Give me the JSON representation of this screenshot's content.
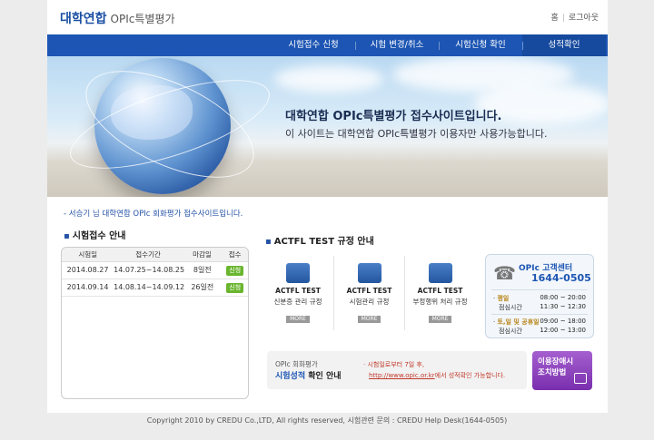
{
  "header": {
    "logo_main": "대학연합",
    "logo_sub": "OPIc특별평가",
    "util": [
      "홈",
      "로그아웃"
    ]
  },
  "nav": [
    "시험접수 신청",
    "시험 변경/취소",
    "시험신청 확인",
    "성적확인"
  ],
  "hero": {
    "title": "대학연합 OPIc특별평가 접수사이트입니다.",
    "subtitle": "이 사이트는 대학연합 OPIc특별평가 이용자만 사용가능합니다."
  },
  "notice": "- 서승기 님 대학연합 OPIc 회화평가 접수사이트입니다.",
  "schedule": {
    "title": "시험접수 안내",
    "columns": [
      "시험일",
      "접수기간",
      "마감일",
      "접수"
    ],
    "rows": [
      {
        "date": "2014.08.27",
        "period": "14.07.25~14.08.25",
        "deadline": "8일전",
        "action": "신청"
      },
      {
        "date": "2014.09.14",
        "period": "14.08.14~14.09.12",
        "deadline": "26일전",
        "action": "신청"
      }
    ]
  },
  "rules": {
    "title": "ACTFL TEST 규정 안내",
    "items": [
      {
        "title": "ACTFL TEST",
        "desc": "신분증 관리 규정",
        "more": "MORE"
      },
      {
        "title": "ACTFL TEST",
        "desc": "시험관리 규정",
        "more": "MORE"
      },
      {
        "title": "ACTFL TEST",
        "desc": "부정행위 처리 규정",
        "more": "MORE"
      }
    ]
  },
  "customer_center": {
    "title": "OPIc 고객센터",
    "phone": "1644-0505",
    "weekday_label": "평일",
    "weekday_sub": "점심시간",
    "weekday_hours": "08:00 ~ 20:00",
    "weekday_lunch": "11:30 ~ 12:30",
    "weekend_label": "토,일 및 공휴일",
    "weekend_sub": "점심시간",
    "weekend_hours": "09:00 ~ 18:00",
    "weekend_lunch": "12:00 ~ 13:00"
  },
  "score_banner": {
    "line1": "OPIc 회화평가",
    "line2_a": "시험성적",
    "line2_b": "확인 안내",
    "right1": "· 시험일로부터 7일 후,",
    "right2_link": "http://www.opic.or.kr",
    "right2_rest": "에서 성적확인 가능합니다."
  },
  "cta": {
    "line1": "이용장애시",
    "line2": "조치방법"
  },
  "footer": "Copyright 2010 by CREDU Co.,LTD, All rights reserved,   시험관련 문의 : CREDU Help Desk(1644-0505)"
}
